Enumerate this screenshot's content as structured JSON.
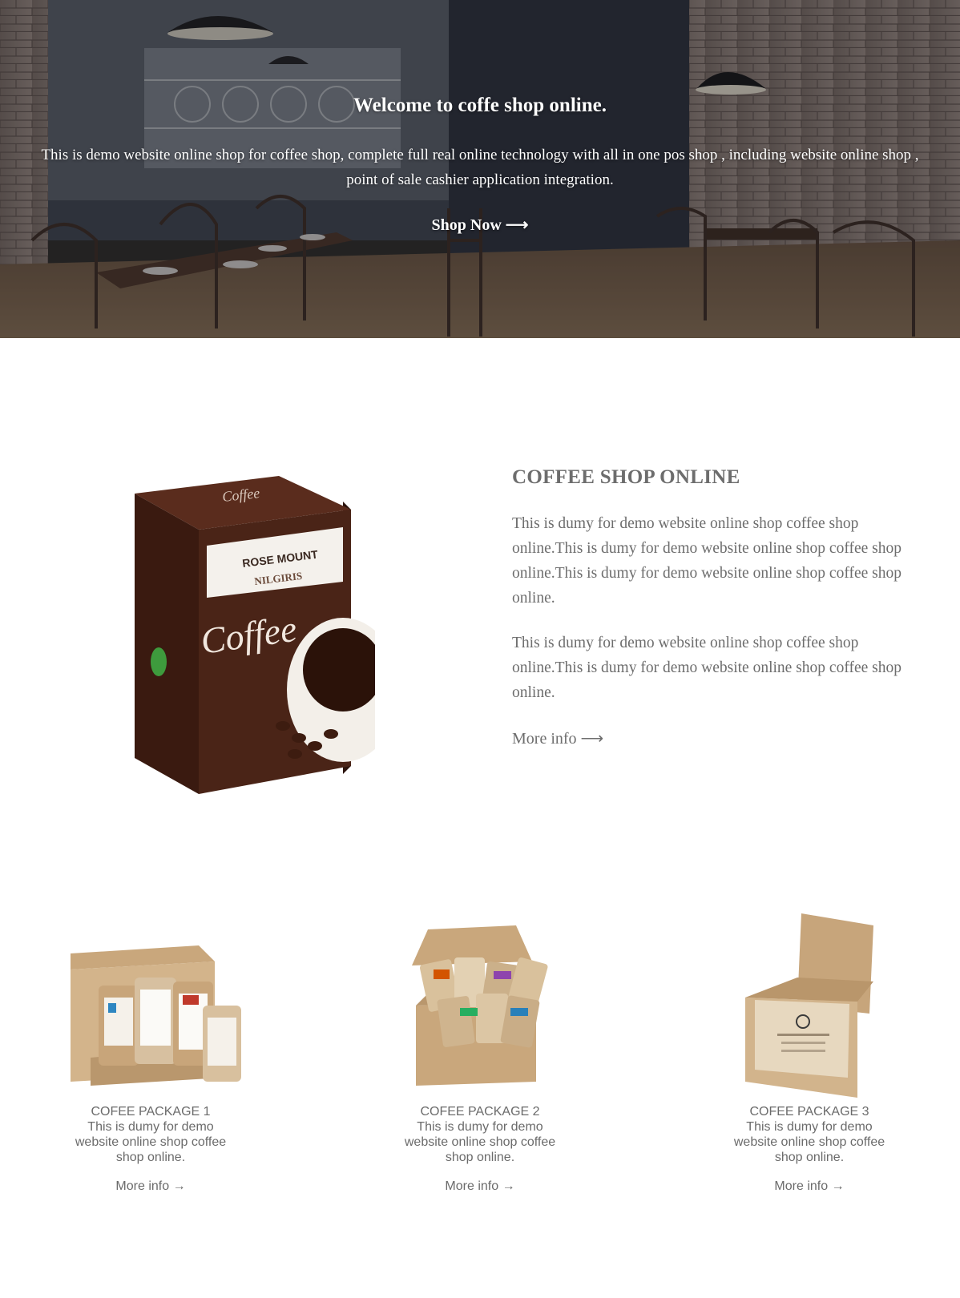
{
  "hero": {
    "title": "Welcome to coffe shop online.",
    "description": "This is demo website online shop for coffee shop, complete full real online technology with all in one pos shop , including website online shop , point of sale cashier application integration.",
    "cta_label": "Shop Now",
    "cta_arrow": "⟶"
  },
  "about": {
    "title": "COFFEE SHOP ONLINE",
    "paragraph_1": "This is dumy for demo website online shop coffee shop online.This is dumy for demo website online shop coffee shop online.This is dumy for demo website online shop coffee shop online.",
    "paragraph_2": "This is dumy for demo website online shop coffee shop online.This is dumy for demo website online shop coffee shop online.",
    "link_label": "More info",
    "link_arrow": "⟶",
    "product_brand": "ROSE MOUNT",
    "product_sub": "NILGIRIS",
    "product_name": "Coffee"
  },
  "packages": [
    {
      "title": "COFEE PACKAGE 1",
      "description": "This is dumy for demo website online shop coffee shop online.",
      "link_label": "More info →"
    },
    {
      "title": "COFEE PACKAGE 2",
      "description": "This is dumy for demo website online shop coffee shop online.",
      "link_label": "More info →"
    },
    {
      "title": "COFEE PACKAGE 3",
      "description": "This is dumy for demo website online shop coffee shop online.",
      "link_label": "More info →"
    }
  ],
  "colors": {
    "text": "#6b6b6b",
    "hero_text": "#ffffff",
    "coffee_box": "#4a2417",
    "kraft": "#c9a77c"
  }
}
